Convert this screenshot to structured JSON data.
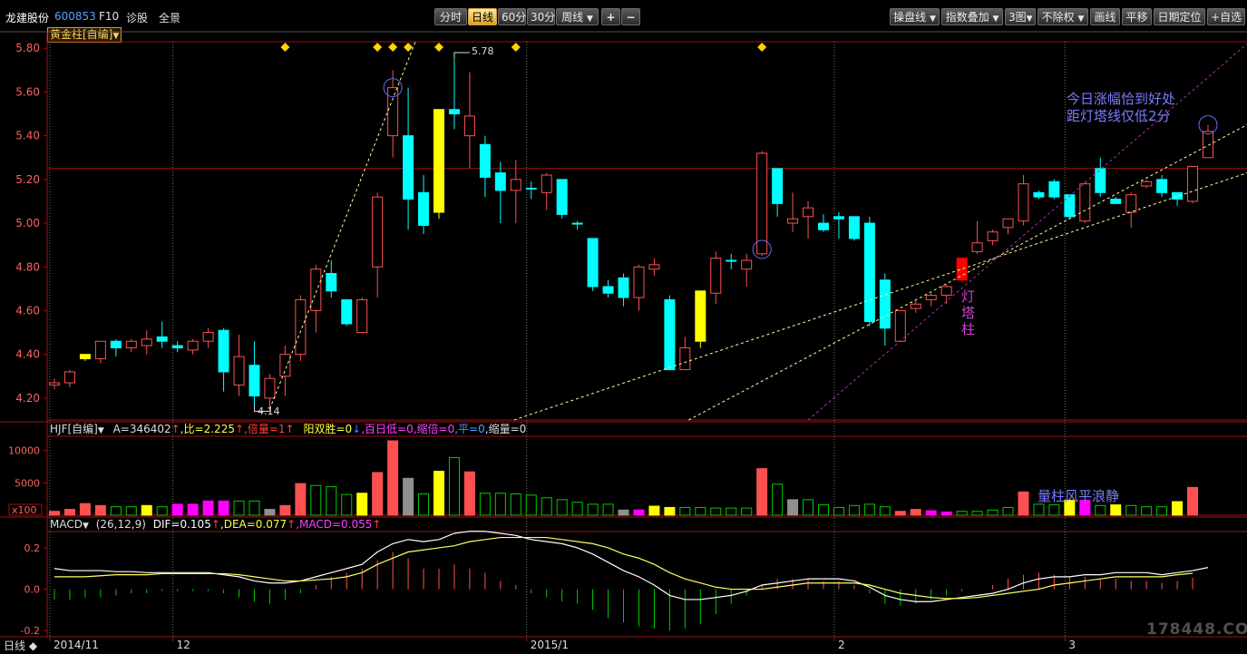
{
  "header": {
    "stock_name": "龙建股份",
    "stock_code": "600853",
    "f10": "F10",
    "diagnose": "诊股",
    "panorama": "全景"
  },
  "periods": [
    "分时",
    "日线",
    "60分",
    "30分",
    "周线"
  ],
  "period_active": 1,
  "zoom_in": "+",
  "zoom_out": "−",
  "toolbar_right": {
    "cao_pan": "操盘线",
    "index_overlay": "指数叠加",
    "charts": "3图",
    "no_rights": "不除权",
    "draw_line": "画线",
    "pan": "平移",
    "date_locate": "日期定位",
    "custom": "自选"
  },
  "indicator1": "黄金柱[自编]",
  "vol_bar": {
    "name": "HJF[自编]",
    "A": "A=346402",
    "bi": ",比=2.225",
    "bei": ",倍量=1",
    "yang": "阳双胜=0",
    "bai": ",百日低=0",
    "suo": ",缩倍=0",
    "ping": ",平=0",
    "sl": ",缩量=0",
    "arrow_up": "↑",
    "arrow_down": "↓"
  },
  "macd_bar": {
    "name": "MACD",
    "params": "(26,12,9)",
    "dif": "DIF=0.105",
    "dea": ",DEA=0.077",
    "macd": ",MACD=0.055",
    "arrow_up": "↑"
  },
  "annotations": {
    "high_price": "5.78",
    "low_price": "4.14",
    "note_line1": "今日涨幅恰到好处",
    "note_line2": "距灯塔线仅低2分",
    "lighthouse": [
      "灯",
      "塔",
      "柱"
    ],
    "volume_note": "量柱风平浪静",
    "x100": "x100"
  },
  "footer": {
    "period": "日线",
    "diamond": "◆"
  },
  "watermark": "178448.COM",
  "colors": {
    "up": "#ff5050",
    "down": "#00ffff",
    "gold": "#ffff00",
    "lighthouse": "#ff0000",
    "magenta": "#ff00ff",
    "grid": "#a01010",
    "text_axis": "#ff6060",
    "note": "#7b7bff",
    "vol_green": "#00cc00"
  },
  "chart_data": {
    "type": "candlestick",
    "y_ticks": [
      5.8,
      5.6,
      5.4,
      5.2,
      5.0,
      4.8,
      4.6,
      4.4,
      4.2
    ],
    "ylim": [
      4.1,
      5.83
    ],
    "x_labels": [
      {
        "i": 0,
        "t": "2014/11"
      },
      {
        "i": 8,
        "t": "12"
      },
      {
        "i": 31,
        "t": "2015/1"
      },
      {
        "i": 51,
        "t": "2"
      },
      {
        "i": 66,
        "t": "3"
      }
    ],
    "signal_markers": [
      15,
      21,
      22,
      23,
      25,
      30,
      46
    ],
    "candles": [
      [
        4.26,
        4.27,
        4.24,
        4.29,
        "up"
      ],
      [
        4.27,
        4.32,
        4.25,
        4.33,
        "up"
      ],
      [
        4.38,
        4.4,
        4.37,
        4.4,
        "gold"
      ],
      [
        4.38,
        4.46,
        4.36,
        4.46,
        "up"
      ],
      [
        4.46,
        4.43,
        4.39,
        4.47,
        "down"
      ],
      [
        4.43,
        4.46,
        4.41,
        4.47,
        "up"
      ],
      [
        4.44,
        4.47,
        4.4,
        4.51,
        "up"
      ],
      [
        4.48,
        4.46,
        4.43,
        4.55,
        "down"
      ],
      [
        4.44,
        4.43,
        4.41,
        4.46,
        "down"
      ],
      [
        4.42,
        4.46,
        4.4,
        4.47,
        "up"
      ],
      [
        4.46,
        4.5,
        4.43,
        4.52,
        "up"
      ],
      [
        4.51,
        4.32,
        4.23,
        4.52,
        "down"
      ],
      [
        4.26,
        4.39,
        4.21,
        4.49,
        "up"
      ],
      [
        4.35,
        4.21,
        4.17,
        4.46,
        "down"
      ],
      [
        4.2,
        4.29,
        4.14,
        4.31,
        "up"
      ],
      [
        4.3,
        4.4,
        4.21,
        4.44,
        "up"
      ],
      [
        4.4,
        4.65,
        4.37,
        4.67,
        "up"
      ],
      [
        4.6,
        4.79,
        4.5,
        4.81,
        "up"
      ],
      [
        4.77,
        4.69,
        4.66,
        4.83,
        "down"
      ],
      [
        4.65,
        4.54,
        4.53,
        4.65,
        "down"
      ],
      [
        4.5,
        4.65,
        4.5,
        4.66,
        "up"
      ],
      [
        4.8,
        5.12,
        4.66,
        5.14,
        "up"
      ],
      [
        5.4,
        5.62,
        5.3,
        5.7,
        "up"
      ],
      [
        5.4,
        5.11,
        4.97,
        5.62,
        "down"
      ],
      [
        5.14,
        4.99,
        4.95,
        5.22,
        "down"
      ],
      [
        5.05,
        5.52,
        5.02,
        5.52,
        "gold"
      ],
      [
        5.5,
        5.52,
        5.43,
        5.78,
        "down"
      ],
      [
        5.4,
        5.49,
        5.25,
        5.69,
        "up"
      ],
      [
        5.36,
        5.21,
        5.12,
        5.4,
        "down"
      ],
      [
        5.23,
        5.15,
        5.0,
        5.28,
        "down"
      ],
      [
        5.15,
        5.2,
        5.0,
        5.29,
        "up"
      ],
      [
        5.16,
        5.16,
        5.11,
        5.19,
        "down"
      ],
      [
        5.14,
        5.22,
        5.06,
        5.23,
        "up"
      ],
      [
        5.2,
        5.04,
        5.02,
        5.2,
        "down"
      ],
      [
        5.0,
        5.0,
        4.97,
        5.01,
        "down"
      ],
      [
        4.93,
        4.71,
        4.69,
        4.93,
        "down"
      ],
      [
        4.71,
        4.68,
        4.66,
        4.74,
        "down"
      ],
      [
        4.75,
        4.66,
        4.62,
        4.77,
        "down"
      ],
      [
        4.66,
        4.8,
        4.6,
        4.81,
        "up"
      ],
      [
        4.79,
        4.81,
        4.76,
        4.84,
        "up"
      ],
      [
        4.65,
        4.33,
        4.33,
        4.67,
        "down"
      ],
      [
        4.33,
        4.43,
        4.33,
        4.48,
        "up"
      ],
      [
        4.46,
        4.69,
        4.43,
        4.69,
        "gold"
      ],
      [
        4.68,
        4.84,
        4.63,
        4.87,
        "up"
      ],
      [
        4.83,
        4.83,
        4.79,
        4.86,
        "down"
      ],
      [
        4.79,
        4.83,
        4.71,
        4.86,
        "up"
      ],
      [
        4.86,
        5.32,
        4.85,
        5.33,
        "up"
      ],
      [
        5.25,
        5.09,
        5.03,
        5.25,
        "down"
      ],
      [
        5.0,
        5.02,
        4.96,
        5.14,
        "up"
      ],
      [
        5.03,
        5.07,
        4.93,
        5.1,
        "up"
      ],
      [
        4.97,
        5.0,
        4.96,
        5.04,
        "down"
      ],
      [
        5.02,
        5.03,
        4.93,
        5.05,
        "down"
      ],
      [
        5.03,
        4.93,
        4.92,
        5.03,
        "down"
      ],
      [
        5.0,
        4.55,
        4.53,
        5.03,
        "down"
      ],
      [
        4.74,
        4.52,
        4.44,
        4.77,
        "down"
      ],
      [
        4.46,
        4.6,
        4.46,
        4.6,
        "up"
      ],
      [
        4.61,
        4.63,
        4.59,
        4.65,
        "up"
      ],
      [
        4.65,
        4.67,
        4.62,
        4.68,
        "up"
      ],
      [
        4.67,
        4.71,
        4.63,
        4.72,
        "up"
      ],
      [
        4.74,
        4.84,
        4.73,
        4.84,
        "lighthouse"
      ],
      [
        4.87,
        4.91,
        4.86,
        5.01,
        "up"
      ],
      [
        4.92,
        4.96,
        4.9,
        4.97,
        "up"
      ],
      [
        4.98,
        5.02,
        4.95,
        5.02,
        "up"
      ],
      [
        5.01,
        5.18,
        4.99,
        5.22,
        "up"
      ],
      [
        5.14,
        5.12,
        5.11,
        5.15,
        "down"
      ],
      [
        5.19,
        5.12,
        5.11,
        5.2,
        "down"
      ],
      [
        5.13,
        5.03,
        5.02,
        5.13,
        "down"
      ],
      [
        5.01,
        5.18,
        5.0,
        5.19,
        "up"
      ],
      [
        5.25,
        5.14,
        5.12,
        5.3,
        "down"
      ],
      [
        5.11,
        5.09,
        5.09,
        5.12,
        "down"
      ],
      [
        5.05,
        5.13,
        4.98,
        5.14,
        "up"
      ],
      [
        5.17,
        5.19,
        5.16,
        5.2,
        "up"
      ],
      [
        5.2,
        5.14,
        5.12,
        5.22,
        "down"
      ],
      [
        5.14,
        5.11,
        5.08,
        5.14,
        "down"
      ],
      [
        5.1,
        5.26,
        5.09,
        5.26,
        "up"
      ],
      [
        5.3,
        5.42,
        5.3,
        5.45,
        "up"
      ]
    ],
    "volume_ticks": [
      10000,
      5000
    ],
    "volume_max": 11500,
    "volumes": [
      [
        600,
        "up"
      ],
      [
        900,
        "up"
      ],
      [
        1800,
        "up"
      ],
      [
        1500,
        "up"
      ],
      [
        1300,
        "vg"
      ],
      [
        1300,
        "vg"
      ],
      [
        1500,
        "gold"
      ],
      [
        1300,
        "vg"
      ],
      [
        1700,
        "mag"
      ],
      [
        1700,
        "mag"
      ],
      [
        2200,
        "mag"
      ],
      [
        2200,
        "mag"
      ],
      [
        2200,
        "vg"
      ],
      [
        2200,
        "vg"
      ],
      [
        900,
        "gray"
      ],
      [
        1500,
        "up"
      ],
      [
        4900,
        "up"
      ],
      [
        4600,
        "vg"
      ],
      [
        4400,
        "vg"
      ],
      [
        3200,
        "vg"
      ],
      [
        3400,
        "gold"
      ],
      [
        6600,
        "up"
      ],
      [
        11500,
        "up"
      ],
      [
        5700,
        "gray"
      ],
      [
        3300,
        "vg"
      ],
      [
        6800,
        "gold"
      ],
      [
        8900,
        "vg"
      ],
      [
        6700,
        "up"
      ],
      [
        3400,
        "vg"
      ],
      [
        3400,
        "vg"
      ],
      [
        3300,
        "vg"
      ],
      [
        3100,
        "vg"
      ],
      [
        2700,
        "vg"
      ],
      [
        2400,
        "vg"
      ],
      [
        2000,
        "vg"
      ],
      [
        1700,
        "vg"
      ],
      [
        1700,
        "vg"
      ],
      [
        800,
        "gray"
      ],
      [
        800,
        "mag"
      ],
      [
        1400,
        "gold"
      ],
      [
        1200,
        "gold"
      ],
      [
        1200,
        "vg"
      ],
      [
        1200,
        "vg"
      ],
      [
        1100,
        "vg"
      ],
      [
        1100,
        "vg"
      ],
      [
        1100,
        "vg"
      ],
      [
        7200,
        "up"
      ],
      [
        4800,
        "vg"
      ],
      [
        2400,
        "gray"
      ],
      [
        2400,
        "vg"
      ],
      [
        1600,
        "vg"
      ],
      [
        1200,
        "vg"
      ],
      [
        1500,
        "vg"
      ],
      [
        1700,
        "vg"
      ],
      [
        1300,
        "vg"
      ],
      [
        600,
        "up"
      ],
      [
        900,
        "up"
      ],
      [
        700,
        "mag"
      ],
      [
        500,
        "mag"
      ],
      [
        600,
        "vg"
      ],
      [
        600,
        "vg"
      ],
      [
        800,
        "vg"
      ],
      [
        1200,
        "vg"
      ],
      [
        3600,
        "up"
      ],
      [
        1700,
        "vg"
      ],
      [
        1600,
        "vg"
      ],
      [
        2300,
        "gold"
      ],
      [
        2300,
        "mag"
      ],
      [
        1500,
        "vg"
      ],
      [
        1600,
        "gold"
      ],
      [
        1500,
        "vg"
      ],
      [
        1300,
        "vg"
      ],
      [
        1300,
        "vg"
      ],
      [
        2100,
        "gold"
      ],
      [
        4300,
        "up"
      ]
    ],
    "macd_ticks": [
      0.2,
      0.0,
      -0.2
    ],
    "macd_ylim": [
      -0.23,
      0.27
    ],
    "dif": [
      0.1,
      0.09,
      0.09,
      0.09,
      0.085,
      0.085,
      0.08,
      0.08,
      0.08,
      0.08,
      0.08,
      0.07,
      0.06,
      0.04,
      0.03,
      0.03,
      0.04,
      0.06,
      0.08,
      0.1,
      0.12,
      0.18,
      0.22,
      0.24,
      0.23,
      0.24,
      0.27,
      0.28,
      0.28,
      0.27,
      0.26,
      0.24,
      0.23,
      0.22,
      0.2,
      0.17,
      0.13,
      0.09,
      0.06,
      0.02,
      -0.03,
      -0.05,
      -0.05,
      -0.04,
      -0.03,
      -0.01,
      0.02,
      0.03,
      0.04,
      0.05,
      0.05,
      0.05,
      0.04,
      0.01,
      -0.03,
      -0.05,
      -0.06,
      -0.06,
      -0.05,
      -0.04,
      -0.03,
      -0.02,
      0.0,
      0.03,
      0.05,
      0.06,
      0.06,
      0.07,
      0.07,
      0.08,
      0.08,
      0.08,
      0.07,
      0.08,
      0.09,
      0.105
    ],
    "dea": [
      0.06,
      0.06,
      0.06,
      0.065,
      0.07,
      0.07,
      0.07,
      0.075,
      0.075,
      0.075,
      0.075,
      0.075,
      0.07,
      0.06,
      0.05,
      0.04,
      0.04,
      0.045,
      0.05,
      0.06,
      0.08,
      0.12,
      0.15,
      0.18,
      0.19,
      0.2,
      0.21,
      0.23,
      0.24,
      0.25,
      0.25,
      0.25,
      0.25,
      0.24,
      0.23,
      0.22,
      0.2,
      0.17,
      0.15,
      0.12,
      0.08,
      0.05,
      0.03,
      0.01,
      0.0,
      0.0,
      0.0,
      0.01,
      0.02,
      0.03,
      0.03,
      0.03,
      0.03,
      0.02,
      0.0,
      -0.02,
      -0.03,
      -0.04,
      -0.045,
      -0.045,
      -0.04,
      -0.03,
      -0.02,
      -0.01,
      0.0,
      0.02,
      0.03,
      0.04,
      0.05,
      0.06,
      0.06,
      0.06,
      0.06,
      0.07,
      0.077
    ],
    "macd_hist": [
      -0.05,
      -0.05,
      -0.04,
      -0.04,
      -0.03,
      -0.02,
      -0.02,
      -0.01,
      -0.01,
      -0.01,
      -0.01,
      -0.02,
      -0.04,
      -0.06,
      -0.07,
      -0.05,
      -0.02,
      0.02,
      0.06,
      0.08,
      0.1,
      0.14,
      0.18,
      0.15,
      0.1,
      0.1,
      0.12,
      0.1,
      0.08,
      0.04,
      0.02,
      -0.02,
      -0.04,
      -0.06,
      -0.07,
      -0.1,
      -0.14,
      -0.16,
      -0.18,
      -0.19,
      -0.2,
      -0.19,
      -0.17,
      -0.12,
      -0.07,
      -0.03,
      0.02,
      0.05,
      0.05,
      0.05,
      0.04,
      0.04,
      0.02,
      -0.02,
      -0.07,
      -0.08,
      -0.07,
      -0.05,
      -0.03,
      -0.01,
      0.0,
      0.02,
      0.05,
      0.07,
      0.08,
      0.07,
      0.06,
      0.06,
      0.05,
      0.05,
      0.04,
      0.04,
      0.03,
      0.04,
      0.055
    ]
  }
}
